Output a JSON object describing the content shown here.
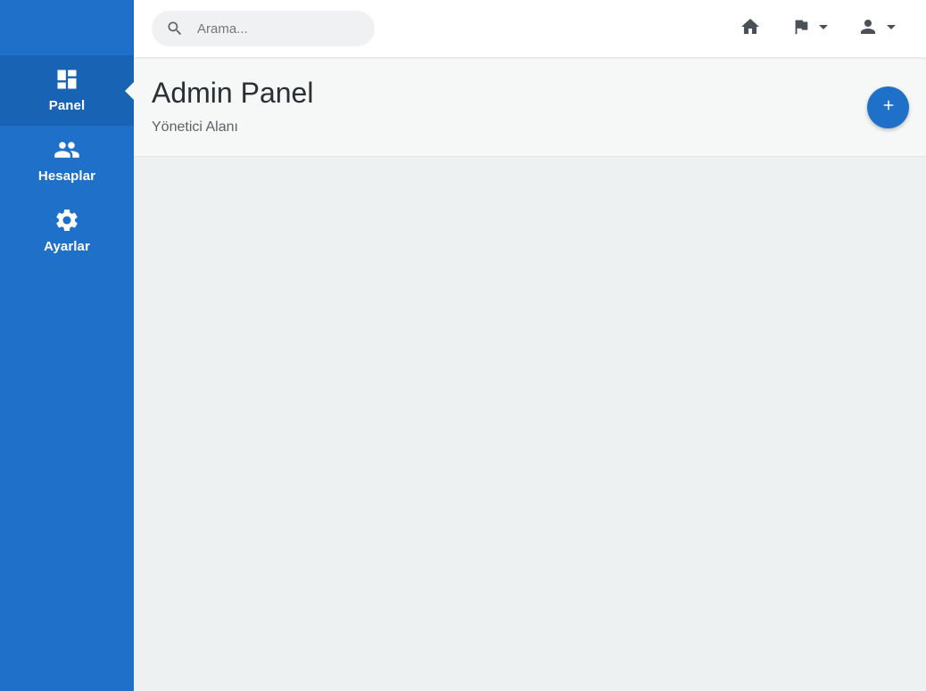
{
  "sidebar": {
    "items": [
      {
        "label": "Panel",
        "icon": "dashboard-icon",
        "active": true
      },
      {
        "label": "Hesaplar",
        "icon": "people-icon",
        "active": false
      },
      {
        "label": "Ayarlar",
        "icon": "gear-icon",
        "active": false
      }
    ]
  },
  "topbar": {
    "search": {
      "placeholder": "Arama...",
      "value": "",
      "icon": "search-icon"
    },
    "actions": [
      {
        "icon": "home-icon"
      },
      {
        "icon": "flag-icon",
        "dropdown": true
      },
      {
        "icon": "user-icon",
        "dropdown": true
      }
    ]
  },
  "header": {
    "title": "Admin Panel",
    "subtitle": "Yönetici Alanı",
    "add_button_icon": "plus-icon"
  },
  "colors": {
    "primary": "#1e70c8",
    "primary_active": "#1963b5",
    "background": "#eef1f2",
    "header_background": "#f6f7f7",
    "icon_dark": "#4a5058"
  }
}
